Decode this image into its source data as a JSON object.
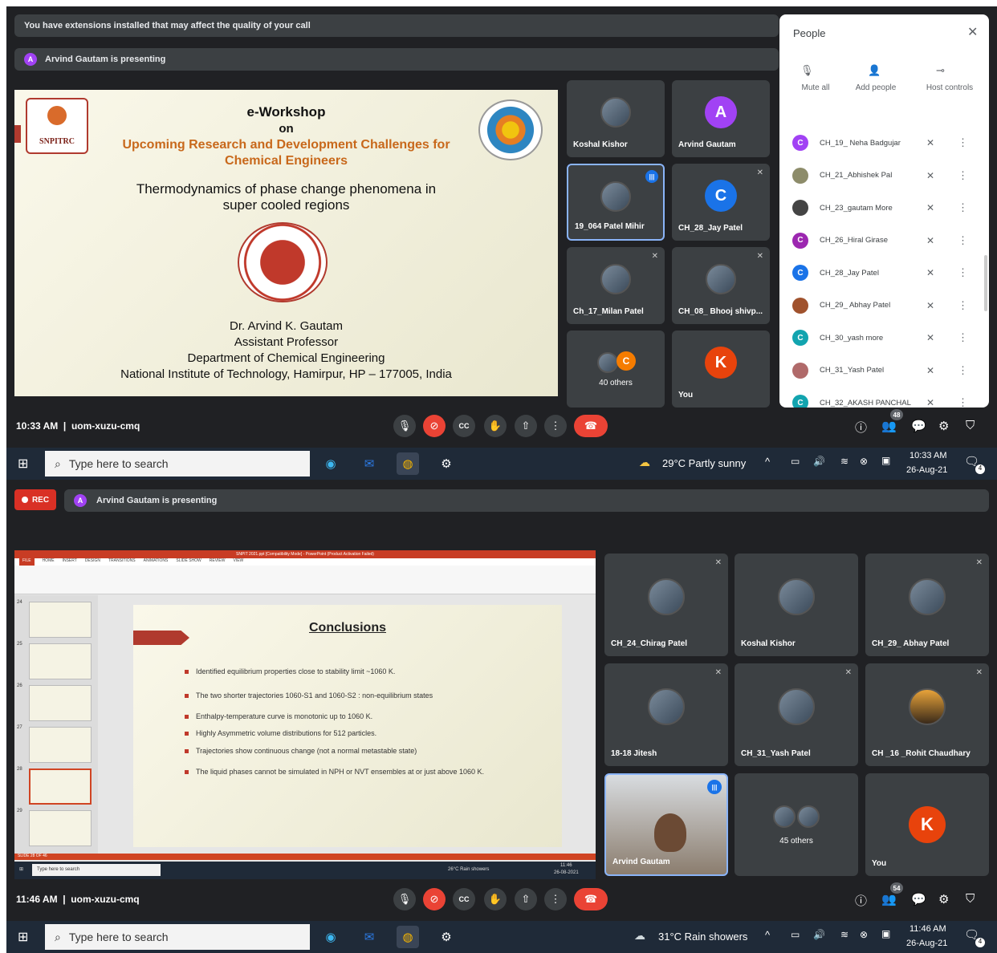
{
  "top": {
    "warning": "You have extensions installed that may affect the quality of your call",
    "presenting": "Arvind Gautam is presenting",
    "presenter_initial": "A",
    "slide": {
      "title1": "e-Workshop",
      "title2": "on",
      "title3": "Upcoming Research and Development Challenges for",
      "title4": "Chemical Engineers",
      "topic1": "Thermodynamics of phase change phenomena in",
      "topic2": "super cooled regions",
      "logo_left": "SNPITRC",
      "author": "Dr. Arvind K. Gautam",
      "role": "Assistant Professor",
      "dept": "Department of Chemical Engineering",
      "inst": "National Institute of Technology, Hamirpur, HP – 177005, India"
    },
    "tiles": [
      {
        "name": "Koshal Kishor"
      },
      {
        "name": "Arvind Gautam",
        "initial": "A",
        "color": "#a142f4"
      },
      {
        "name": "19_064 Patel Mihir"
      },
      {
        "name": "CH_28_Jay Patel",
        "initial": "C",
        "color": "#1a73e8"
      },
      {
        "name": "Ch_17_Milan Patel"
      },
      {
        "name": "CH_08_ Bhooj shivp..."
      },
      {
        "name": "40 others",
        "initial": "C",
        "color": "#f57c00"
      },
      {
        "name": "You",
        "initial": "K",
        "color": "#e8430c"
      }
    ],
    "time": "10:33 AM",
    "code": "uom-xuzu-cmq",
    "participants_badge": "48",
    "people": {
      "title": "People",
      "mute_all": "Mute all",
      "add_people": "Add people",
      "host_controls": "Host controls",
      "rows": [
        {
          "name": "CH_19_ Neha Badgujar",
          "initial": "C",
          "color": "#a142f4"
        },
        {
          "name": "CH_21_Abhishek Pal",
          "initial": "",
          "color": "#8d8c6a"
        },
        {
          "name": "CH_23_gautam More",
          "initial": "",
          "color": "#444"
        },
        {
          "name": "CH_26_Hiral Girase",
          "initial": "C",
          "color": "#9c27b0"
        },
        {
          "name": "CH_28_Jay Patel",
          "initial": "C",
          "color": "#1a73e8"
        },
        {
          "name": "CH_29_ Abhay Patel",
          "initial": "",
          "color": "#a0522d"
        },
        {
          "name": "CH_30_yash more",
          "initial": "C",
          "color": "#12a4af"
        },
        {
          "name": "CH_31_Yash Patel",
          "initial": "",
          "color": "#b06a6a"
        },
        {
          "name": "CH_32_AKASH PANCHAL",
          "initial": "C",
          "color": "#12a4af"
        }
      ]
    },
    "taskbar": {
      "search": "Type here to search",
      "weather": "29°C  Partly sunny",
      "time": "10:33 AM",
      "date": "26-Aug-21",
      "notif": "4"
    }
  },
  "bottom": {
    "rec": "REC",
    "presenting": "Arvind Gautam is presenting",
    "presenter_initial": "A",
    "ppt": {
      "window_title": "SNPIT 2021.ppt [Compatibility Mode] - PowerPoint (Product Activation Failed)",
      "tabs": [
        "FILE",
        "HOME",
        "INSERT",
        "DESIGN",
        "TRANSITIONS",
        "ANIMATIONS",
        "SLIDE SHOW",
        "REVIEW",
        "VIEW"
      ],
      "thumb_nums": [
        "24",
        "25",
        "26",
        "27",
        "28",
        "29"
      ],
      "heading": "Conclusions",
      "bullets": [
        "Identified equilibrium properties close to stability limit ~1060 K.",
        "The two shorter trajectories 1060-S1 and 1060-S2 : non-equilibrium states",
        "Enthalpy-temperature curve is monotonic up to 1060 K.",
        "Highly Asymmetric volume distributions for 512 particles.",
        "Trajectories show continuous change (not a normal metastable state)",
        "The liquid phases cannot be simulated in NPH or NVT ensembles at or just above 1060 K."
      ],
      "status": "SLIDE 28 OF 46",
      "inner_search": "Type here to search",
      "inner_weather": "26°C  Rain showers",
      "inner_time": "11:46",
      "inner_date": "26-08-2021"
    },
    "tiles": [
      {
        "name": "CH_24_Chirag Patel"
      },
      {
        "name": "Koshal Kishor"
      },
      {
        "name": "CH_29_ Abhay Patel"
      },
      {
        "name": "18-18 Jitesh"
      },
      {
        "name": "CH_31_Yash Patel"
      },
      {
        "name": "CH _16 _Rohit Chaudhary"
      },
      {
        "name": "Arvind Gautam"
      },
      {
        "name": "45 others"
      },
      {
        "name": "You",
        "initial": "K",
        "color": "#e8430c"
      }
    ],
    "time": "11:46 AM",
    "code": "uom-xuzu-cmq",
    "participants_badge": "54",
    "taskbar": {
      "search": "Type here to search",
      "weather": "31°C  Rain showers",
      "time": "11:46 AM",
      "date": "26-Aug-21",
      "notif": "4"
    }
  }
}
